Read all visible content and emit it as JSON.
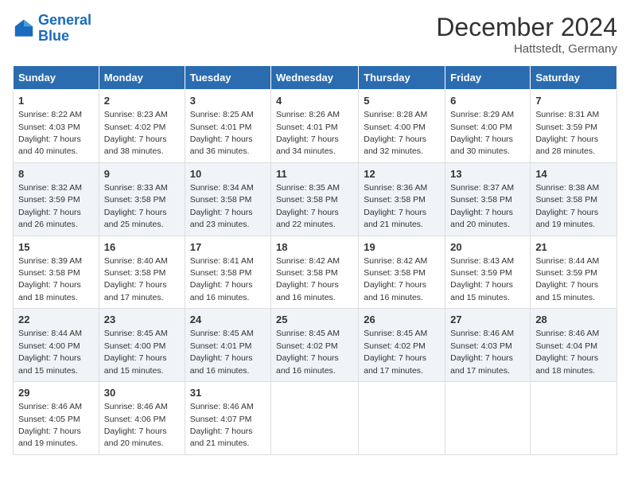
{
  "header": {
    "logo_line1": "General",
    "logo_line2": "Blue",
    "month": "December 2024",
    "location": "Hattstedt, Germany"
  },
  "weekdays": [
    "Sunday",
    "Monday",
    "Tuesday",
    "Wednesday",
    "Thursday",
    "Friday",
    "Saturday"
  ],
  "weeks": [
    [
      {
        "day": "1",
        "info": "Sunrise: 8:22 AM\nSunset: 4:03 PM\nDaylight: 7 hours\nand 40 minutes."
      },
      {
        "day": "2",
        "info": "Sunrise: 8:23 AM\nSunset: 4:02 PM\nDaylight: 7 hours\nand 38 minutes."
      },
      {
        "day": "3",
        "info": "Sunrise: 8:25 AM\nSunset: 4:01 PM\nDaylight: 7 hours\nand 36 minutes."
      },
      {
        "day": "4",
        "info": "Sunrise: 8:26 AM\nSunset: 4:01 PM\nDaylight: 7 hours\nand 34 minutes."
      },
      {
        "day": "5",
        "info": "Sunrise: 8:28 AM\nSunset: 4:00 PM\nDaylight: 7 hours\nand 32 minutes."
      },
      {
        "day": "6",
        "info": "Sunrise: 8:29 AM\nSunset: 4:00 PM\nDaylight: 7 hours\nand 30 minutes."
      },
      {
        "day": "7",
        "info": "Sunrise: 8:31 AM\nSunset: 3:59 PM\nDaylight: 7 hours\nand 28 minutes."
      }
    ],
    [
      {
        "day": "8",
        "info": "Sunrise: 8:32 AM\nSunset: 3:59 PM\nDaylight: 7 hours\nand 26 minutes."
      },
      {
        "day": "9",
        "info": "Sunrise: 8:33 AM\nSunset: 3:58 PM\nDaylight: 7 hours\nand 25 minutes."
      },
      {
        "day": "10",
        "info": "Sunrise: 8:34 AM\nSunset: 3:58 PM\nDaylight: 7 hours\nand 23 minutes."
      },
      {
        "day": "11",
        "info": "Sunrise: 8:35 AM\nSunset: 3:58 PM\nDaylight: 7 hours\nand 22 minutes."
      },
      {
        "day": "12",
        "info": "Sunrise: 8:36 AM\nSunset: 3:58 PM\nDaylight: 7 hours\nand 21 minutes."
      },
      {
        "day": "13",
        "info": "Sunrise: 8:37 AM\nSunset: 3:58 PM\nDaylight: 7 hours\nand 20 minutes."
      },
      {
        "day": "14",
        "info": "Sunrise: 8:38 AM\nSunset: 3:58 PM\nDaylight: 7 hours\nand 19 minutes."
      }
    ],
    [
      {
        "day": "15",
        "info": "Sunrise: 8:39 AM\nSunset: 3:58 PM\nDaylight: 7 hours\nand 18 minutes."
      },
      {
        "day": "16",
        "info": "Sunrise: 8:40 AM\nSunset: 3:58 PM\nDaylight: 7 hours\nand 17 minutes."
      },
      {
        "day": "17",
        "info": "Sunrise: 8:41 AM\nSunset: 3:58 PM\nDaylight: 7 hours\nand 16 minutes."
      },
      {
        "day": "18",
        "info": "Sunrise: 8:42 AM\nSunset: 3:58 PM\nDaylight: 7 hours\nand 16 minutes."
      },
      {
        "day": "19",
        "info": "Sunrise: 8:42 AM\nSunset: 3:58 PM\nDaylight: 7 hours\nand 16 minutes."
      },
      {
        "day": "20",
        "info": "Sunrise: 8:43 AM\nSunset: 3:59 PM\nDaylight: 7 hours\nand 15 minutes."
      },
      {
        "day": "21",
        "info": "Sunrise: 8:44 AM\nSunset: 3:59 PM\nDaylight: 7 hours\nand 15 minutes."
      }
    ],
    [
      {
        "day": "22",
        "info": "Sunrise: 8:44 AM\nSunset: 4:00 PM\nDaylight: 7 hours\nand 15 minutes."
      },
      {
        "day": "23",
        "info": "Sunrise: 8:45 AM\nSunset: 4:00 PM\nDaylight: 7 hours\nand 15 minutes."
      },
      {
        "day": "24",
        "info": "Sunrise: 8:45 AM\nSunset: 4:01 PM\nDaylight: 7 hours\nand 16 minutes."
      },
      {
        "day": "25",
        "info": "Sunrise: 8:45 AM\nSunset: 4:02 PM\nDaylight: 7 hours\nand 16 minutes."
      },
      {
        "day": "26",
        "info": "Sunrise: 8:45 AM\nSunset: 4:02 PM\nDaylight: 7 hours\nand 17 minutes."
      },
      {
        "day": "27",
        "info": "Sunrise: 8:46 AM\nSunset: 4:03 PM\nDaylight: 7 hours\nand 17 minutes."
      },
      {
        "day": "28",
        "info": "Sunrise: 8:46 AM\nSunset: 4:04 PM\nDaylight: 7 hours\nand 18 minutes."
      }
    ],
    [
      {
        "day": "29",
        "info": "Sunrise: 8:46 AM\nSunset: 4:05 PM\nDaylight: 7 hours\nand 19 minutes."
      },
      {
        "day": "30",
        "info": "Sunrise: 8:46 AM\nSunset: 4:06 PM\nDaylight: 7 hours\nand 20 minutes."
      },
      {
        "day": "31",
        "info": "Sunrise: 8:46 AM\nSunset: 4:07 PM\nDaylight: 7 hours\nand 21 minutes."
      },
      null,
      null,
      null,
      null
    ]
  ]
}
